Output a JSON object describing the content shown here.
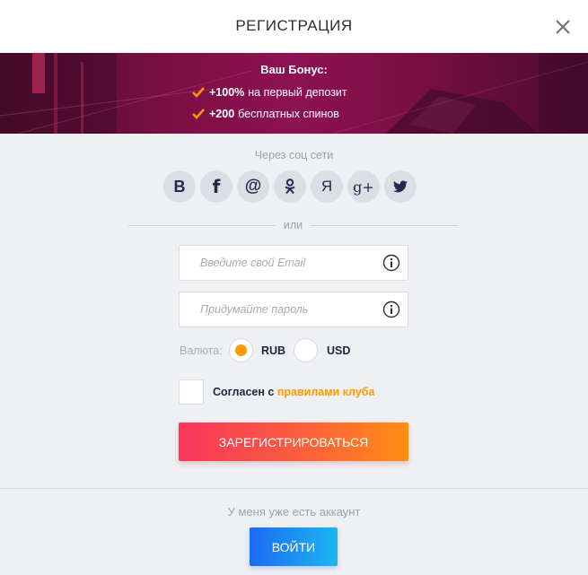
{
  "header": {
    "title": "РЕГИСТРАЦИЯ",
    "close_icon": "close-icon"
  },
  "banner": {
    "title": "Ваш Бонус:",
    "items": [
      {
        "bold": "+100%",
        "text": "на первый депозит",
        "icon": "check-icon"
      },
      {
        "bold": "+200",
        "text": "бесплатных спинов",
        "icon": "check-icon"
      }
    ]
  },
  "social": {
    "caption": "Через соц сети",
    "buttons": [
      {
        "name": "vk",
        "glyph": "В",
        "icon": "vk-icon"
      },
      {
        "name": "facebook",
        "glyph": "f",
        "icon": "facebook-icon"
      },
      {
        "name": "mailru",
        "glyph": "@",
        "icon": "mailru-icon"
      },
      {
        "name": "odnoklassniki",
        "glyph": "",
        "icon": "odnoklassniki-icon"
      },
      {
        "name": "yandex",
        "glyph": "Я",
        "icon": "yandex-icon"
      },
      {
        "name": "google-plus",
        "glyph": "g+",
        "icon": "google-plus-icon"
      },
      {
        "name": "twitter",
        "glyph": "",
        "icon": "twitter-icon"
      }
    ]
  },
  "divider": {
    "text": "или"
  },
  "form": {
    "email": {
      "value": "",
      "placeholder": "Введите свой Email",
      "info_icon": "info-icon"
    },
    "password": {
      "value": "",
      "placeholder": "Придумайте пароль",
      "info_icon": "info-icon"
    },
    "currency": {
      "label": "Валюта:",
      "options": [
        {
          "label": "RUB",
          "selected": true
        },
        {
          "label": "USD",
          "selected": false
        }
      ]
    },
    "agree": {
      "checked": false,
      "text": "Согласен с",
      "link": "правилами клуба"
    },
    "submit_label": "ЗАРЕГИСТРИРОВАТЬСЯ"
  },
  "footer": {
    "text": "У меня уже есть аккаунт",
    "login_label": "ВОЙТИ"
  },
  "colors": {
    "accent_orange": "#ff9a00",
    "register_gradient_start": "#f8365b",
    "register_gradient_end": "#ff8d12",
    "login_gradient_start": "#1d6bf3",
    "login_gradient_end": "#1bb7f0",
    "banner": "#8e1152",
    "background": "#eff0f4"
  }
}
